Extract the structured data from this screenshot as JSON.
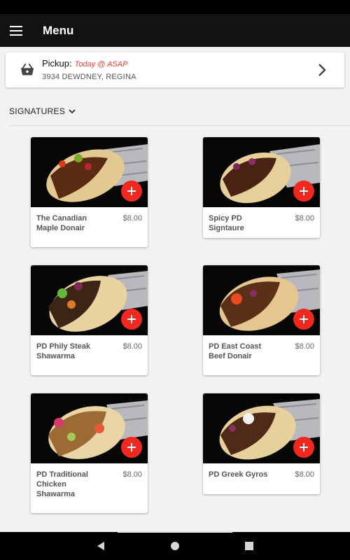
{
  "app_bar": {
    "title": "Menu",
    "menu_icon": "hamburger-icon"
  },
  "pickup": {
    "label": "Pickup:",
    "when": "Today @ ASAP",
    "address": "3934 DEWDNEY, REGINA",
    "icon": "basket-icon"
  },
  "category": {
    "label": "SIGNATURES"
  },
  "colors": {
    "accent": "#f0281f",
    "pickup_when": "#e53b2c",
    "app_bar": "#121212"
  },
  "items": [
    {
      "name": "The Canadian Maple Donair",
      "price": "$8.00"
    },
    {
      "name": "Spicy PD Signtaure",
      "price": "$8.00"
    },
    {
      "name": "PD Phily Steak Shawarma",
      "price": "$8.00"
    },
    {
      "name": "PD East Coast Beef Donair",
      "price": "$8.00"
    },
    {
      "name": "PD Traditional Chicken Shawarma",
      "price": "$8.00"
    },
    {
      "name": "PD Greek Gyros",
      "price": "$8.00"
    }
  ]
}
